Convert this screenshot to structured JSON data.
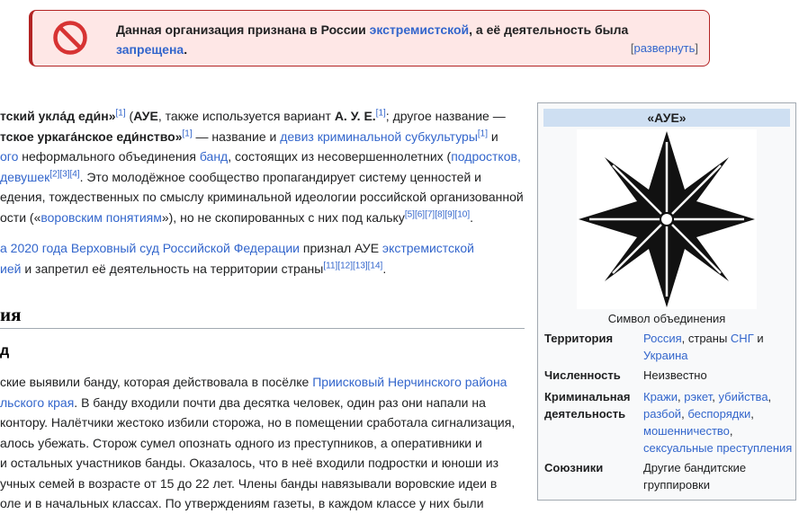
{
  "notice": {
    "text_part1": "Данная организация признана в России ",
    "link1": "экстремистской",
    "text_part2": ", а её деятельность была",
    "link2": "запрещена",
    "text_part3": ".",
    "expand_open": "[",
    "expand_label": "развернуть",
    "expand_close": "]",
    "icon": "prohibited-icon",
    "colors": {
      "border": "#b32424",
      "background": "#fee7e6",
      "icon": "#d73333"
    }
  },
  "article": {
    "lead": {
      "l1": {
        "b1": "тский укла́д еди́н»",
        "r1": "[1]",
        "t1": " (",
        "b2": "АУЕ",
        "t2": ", также используется вариант ",
        "b3": "А. У. Е.",
        "r2": "[1]",
        "t3": "; другое название —"
      },
      "l2": {
        "b1": "тское уркага́нское еди́нство»",
        "r1": "[1]",
        "t1": " — название и ",
        "a1": "девиз криминальной субкультуры",
        "r2": "[1]",
        "t2": " и"
      },
      "l3": {
        "a1": "ого",
        "t1": " неформального объединения ",
        "a2": "банд",
        "t2": ", состоящих из несовершеннолетних (",
        "a3": "подростков,"
      },
      "l4": {
        "a1": "девушек",
        "r1": "[2][3][4]",
        "t1": ". Это молодёжное сообщество пропагандирует систему ценностей и"
      },
      "l5": {
        "t1": "едения, тождественных по смыслу криминальной идеологии российской организованной"
      },
      "l6": {
        "t1": "ости («",
        "a1": "воровским понятиям",
        "t2": "»), но не скопированных с них под кальку",
        "r1": "[5][6][7][8][9][10]",
        "t3": "."
      }
    },
    "para2": {
      "l1": {
        "a1": "а 2020 года",
        "t1": " ",
        "a2": "Верховный суд Российской Федерации",
        "t2": " признал АУЕ ",
        "a3": "экстремистской"
      },
      "l2": {
        "a1": "ией",
        "t1": " и запретил её деятельность на территории страны",
        "r1": "[11][12][13][14]",
        "t2": "."
      }
    },
    "section_heading": "ия",
    "subsection_heading": "д",
    "body": {
      "l1": {
        "t1": "ские выявили банду, которая действовала в посёлке ",
        "a1": "Приисковый",
        "t2": " ",
        "a2": "Нерчинского района"
      },
      "l2": {
        "a1": "льского края",
        "t1": ". В банду входили почти два десятка человек, один раз они напали на"
      },
      "l3": {
        "t1": " контору. Налётчики жестоко избили сторожа, но в помещении сработала сигнализация,"
      },
      "l4": {
        "t1": "алось убежать. Сторож сумел опознать одного из преступников, а оперативники и"
      },
      "l5": {
        "t1": "и остальных участников банды. Оказалось, что в неё входили подростки и юноши из"
      },
      "l6": {
        "t1": "учных семей в возрасте от 15 до 22 лет. Члены банды навязывали воровские идеи в"
      },
      "l7": {
        "t1": "оле и в начальных классах. По утверждениям газеты, в каждом классе у них были"
      }
    }
  },
  "infobox": {
    "title": "«АУЕ»",
    "image_icon": "eight-pointed-star-icon",
    "caption": "Символ объединения",
    "territory": {
      "label": "Территория",
      "link1": "Россия",
      "text1": ", страны ",
      "link2": "СНГ",
      "text2": " и ",
      "link3": "Украина"
    },
    "size": {
      "label": "Численность",
      "value": "Неизвестно"
    },
    "criminal": {
      "label_l1": "Криминальная",
      "label_l2": "деятельность",
      "l1a": "Кражи",
      "l1b": ", ",
      "l1c": "рэкет",
      "l1d": ", ",
      "l1e": "убийства",
      "l1f": ",",
      "l2a": "разбой",
      "l2b": ", ",
      "l2c": "беспорядки",
      "l2d": ",",
      "l3a": "мошенничество",
      "l3b": ",",
      "l4a": "сексуальные преступления"
    },
    "allies": {
      "label": "Союзники",
      "value_l1": "Другие бандитские",
      "value_l2": "группировки"
    }
  }
}
